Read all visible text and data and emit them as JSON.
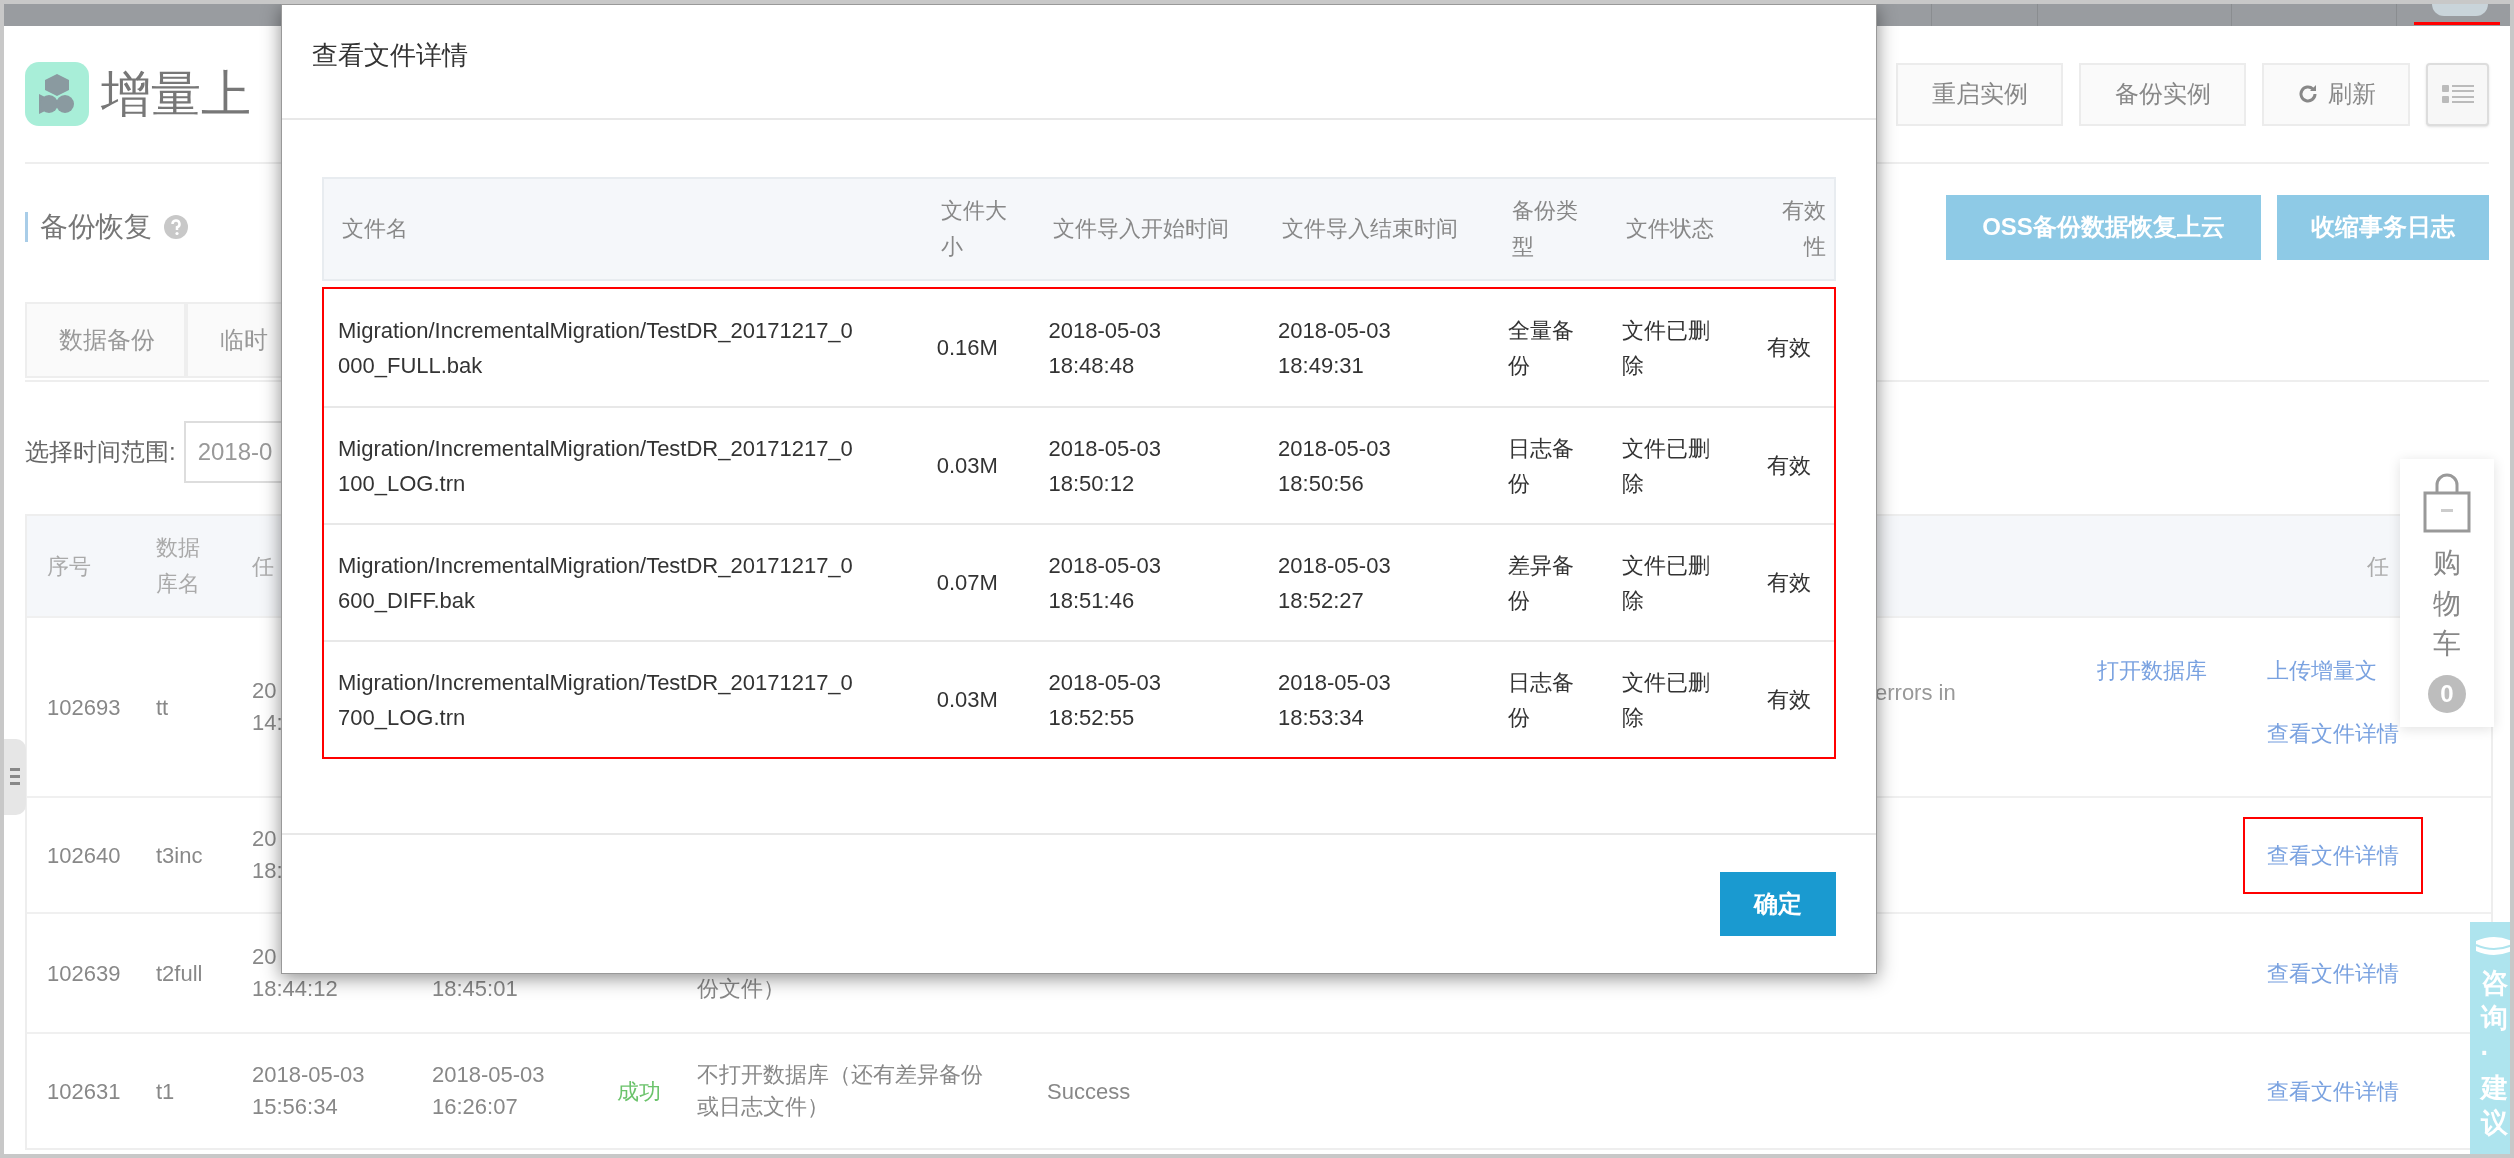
{
  "header": {
    "title": "增量上",
    "buttons": [
      {
        "kind": "plain",
        "label": "重启实例"
      },
      {
        "kind": "plain",
        "label": "备份实例"
      },
      {
        "kind": "refresh",
        "label": "刷新"
      },
      {
        "kind": "list"
      }
    ]
  },
  "section": {
    "title": "备份恢复",
    "actions": [
      "OSS备份数据恢复上云",
      "收缩事务日志"
    ]
  },
  "tabs": [
    {
      "label": "数据备份",
      "selected": false
    },
    {
      "label": "临时",
      "selected": false
    }
  ],
  "filter": {
    "label": "选择时间范围:",
    "value": "2018-0"
  },
  "table": {
    "columns": [
      "序号",
      "数据库名",
      "任"
    ],
    "right_column": "任",
    "rows": [
      {
        "id": "102693",
        "db": "tt",
        "start": [
          "20",
          "14:"
        ],
        "message_end": "errors in",
        "open_actions": [
          {
            "label": "打开数据库",
            "highlighted": false
          }
        ],
        "actions": [
          {
            "label": "上传增量文",
            "highlighted": false
          },
          {
            "label": "查看文件详情",
            "highlighted": false
          }
        ]
      },
      {
        "id": "102640",
        "db": "t3inc",
        "start": [
          "20",
          "18:"
        ],
        "actions": [
          {
            "label": "查看文件详情",
            "highlighted": true
          }
        ]
      },
      {
        "id": "102639",
        "db": "t2full",
        "start": [
          "20",
          "18:44:12"
        ],
        "end": [
          "18:45:01"
        ],
        "description": [
          "份文件）"
        ],
        "actions": [
          {
            "label": "查看文件详情",
            "highlighted": false
          }
        ]
      },
      {
        "id": "102631",
        "db": "t1",
        "start": [
          "2018-05-03",
          "15:56:34"
        ],
        "end": [
          "2018-05-03",
          "16:26:07"
        ],
        "status": {
          "text": "成功",
          "kind": "success"
        },
        "description": [
          "不打开数据库（还有差异备份",
          "或日志文件）"
        ],
        "message": "Success",
        "actions": [
          {
            "label": "查看文件详情",
            "highlighted": false
          }
        ]
      }
    ]
  },
  "dialog": {
    "title": "查看文件详情",
    "columns": [
      "文件名",
      "文件大小",
      "文件导入开始时间",
      "文件导入结束时间",
      "备份类型",
      "文件状态",
      "有效性"
    ],
    "highlighted": true,
    "rows": [
      {
        "cells": [
          "Migration/IncrementalMigration/TestDR_20171217_0000_FULL.bak",
          "0.16M",
          "2018-05-03 18:48:48",
          "2018-05-03 18:49:31",
          "全量备份",
          "文件已删除",
          "有效"
        ]
      },
      {
        "cells": [
          "Migration/IncrementalMigration/TestDR_20171217_0100_LOG.trn",
          "0.03M",
          "2018-05-03 18:50:12",
          "2018-05-03 18:50:56",
          "日志备份",
          "文件已删除",
          "有效"
        ]
      },
      {
        "cells": [
          "Migration/IncrementalMigration/TestDR_20171217_0600_DIFF.bak",
          "0.07M",
          "2018-05-03 18:51:46",
          "2018-05-03 18:52:27",
          "差异备份",
          "文件已删除",
          "有效"
        ]
      },
      {
        "cells": [
          "Migration/IncrementalMigration/TestDR_20171217_0700_LOG.trn",
          "0.03M",
          "2018-05-03 18:52:55",
          "2018-05-03 18:53:34",
          "日志备份",
          "文件已删除",
          "有效"
        ]
      }
    ],
    "confirm": "确定"
  },
  "cart": {
    "label": "购物车",
    "count": "0"
  },
  "consult": {
    "label": "咨询·建议"
  }
}
